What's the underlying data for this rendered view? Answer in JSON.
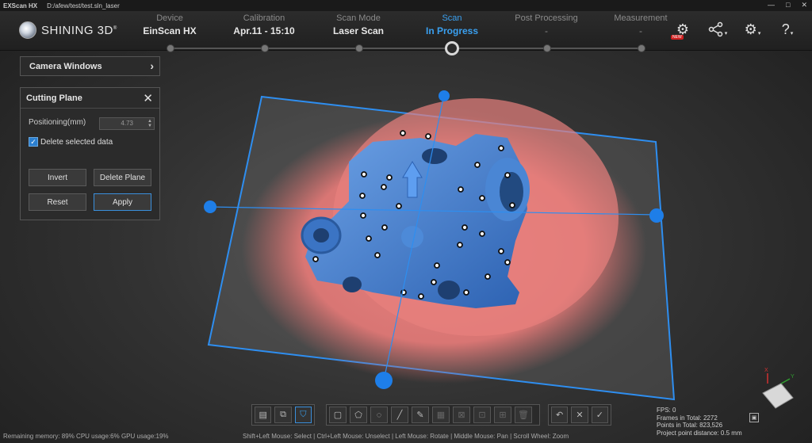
{
  "titlebar": {
    "app_name": "EXScan HX",
    "path": "D:/afew/test/test.sln_laser",
    "minimize": "—",
    "maximize": "□",
    "close": "✕"
  },
  "logo": {
    "text": "SHINING 3D",
    "reg": "®"
  },
  "steps": [
    {
      "label": "Device",
      "value": "EinScan HX"
    },
    {
      "label": "Calibration",
      "value": "Apr.11 - 15:10"
    },
    {
      "label": "Scan Mode",
      "value": "Laser Scan"
    },
    {
      "label": "Scan",
      "value": "In Progress"
    },
    {
      "label": "Post Processing",
      "value": "-"
    },
    {
      "label": "Measurement",
      "value": "-"
    }
  ],
  "top_icons": {
    "new_badge": "NEW",
    "update": "⚙",
    "share": "⚘",
    "settings": "⚙",
    "help": "?",
    "caret": "▾"
  },
  "camera_panel": {
    "title": "Camera Windows",
    "chevron": "›"
  },
  "cutting_plane": {
    "title": "Cutting Plane",
    "close": "✕",
    "positioning_label": "Positioning(mm)",
    "positioning_value": "4.73",
    "delete_selected_label": "Delete selected data",
    "checkbox_mark": "✓",
    "invert": "Invert",
    "delete_plane": "Delete Plane",
    "reset": "Reset",
    "apply": "Apply"
  },
  "stats": {
    "fps": "FPS:  0",
    "frames": "Frames in Total: 2272",
    "points": "Points in Total: 823,526",
    "distance": "Project point distance: 0.5 mm"
  },
  "status_left": "Remaining memory: 89% CPU usage:6%  GPU usage:19%",
  "status_mid": "Shift+Left Mouse: Select | Ctrl+Left Mouse: Unselect | Left Mouse: Rotate | Middle Mouse: Pan | Scroll Wheel: Zoom",
  "axis": {
    "x": "X",
    "y": "Y"
  },
  "colors": {
    "accent": "#3aa0f0",
    "plane_edge": "#2e8ef0",
    "point_cloud": "#e8807e",
    "mesh": "#3f7fd0"
  }
}
